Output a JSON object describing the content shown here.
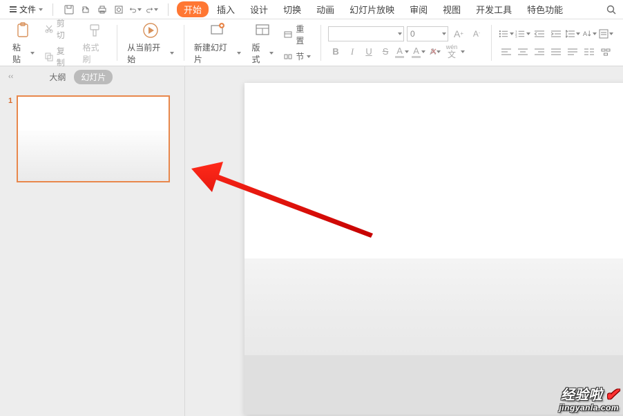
{
  "menu": {
    "file_label": "文件",
    "tabs": [
      "开始",
      "插入",
      "设计",
      "切换",
      "动画",
      "幻灯片放映",
      "审阅",
      "视图",
      "开发工具",
      "特色功能"
    ]
  },
  "ribbon": {
    "paste": "粘贴",
    "cut": "剪切",
    "copy": "复制",
    "format_painter": "格式刷",
    "from_current": "从当前开始",
    "new_slide": "新建幻灯片",
    "layout": "版式",
    "reset": "重置",
    "section": "节",
    "font_size": "0",
    "bold": "B",
    "italic": "I",
    "underline": "U",
    "strike": "S",
    "sup_a": "A",
    "color_a": "A",
    "clear_x": "A",
    "wen": "wén",
    "grow_a": "A⁺",
    "shrink_a": "A⁻"
  },
  "panel": {
    "outline_tab": "大纲",
    "slides_tab": "幻灯片",
    "thumb_num": "1"
  },
  "watermark": {
    "name": "经验啦",
    "url": "jingyanla.com"
  }
}
